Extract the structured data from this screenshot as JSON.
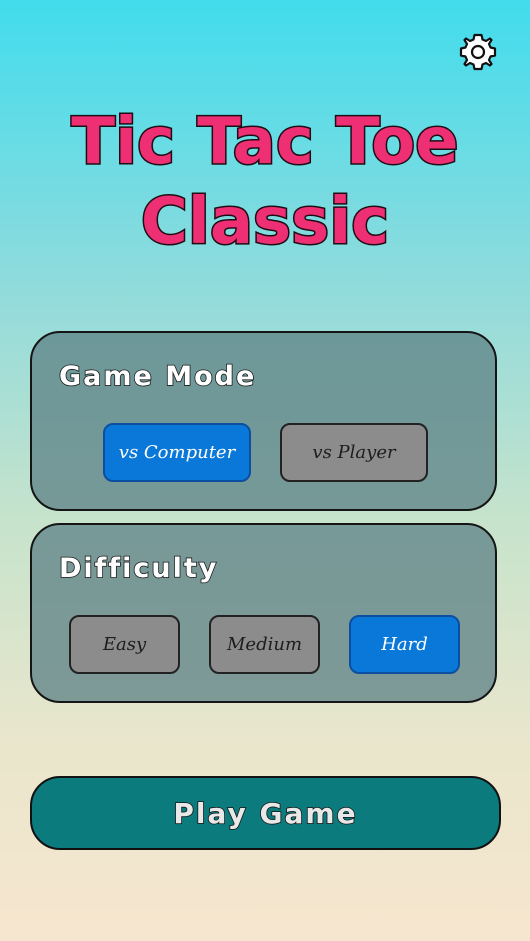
{
  "title": {
    "line1": "Tic Tac Toe",
    "line2": "Classic"
  },
  "icons": {
    "settings": "gear-icon"
  },
  "game_mode": {
    "label": "Game Mode",
    "options": [
      "vs Computer",
      "vs Player"
    ],
    "selected": "vs Computer"
  },
  "difficulty": {
    "label": "Difficulty",
    "options": [
      "Easy",
      "Medium",
      "Hard"
    ],
    "selected": "Hard"
  },
  "play_button": {
    "label": "Play Game"
  },
  "colors": {
    "title": "#ee2f73",
    "selected_option": "#0a78d8",
    "unselected_option": "#8c8c8c",
    "play_button": "#0b7b7e",
    "panel": "#608488"
  }
}
